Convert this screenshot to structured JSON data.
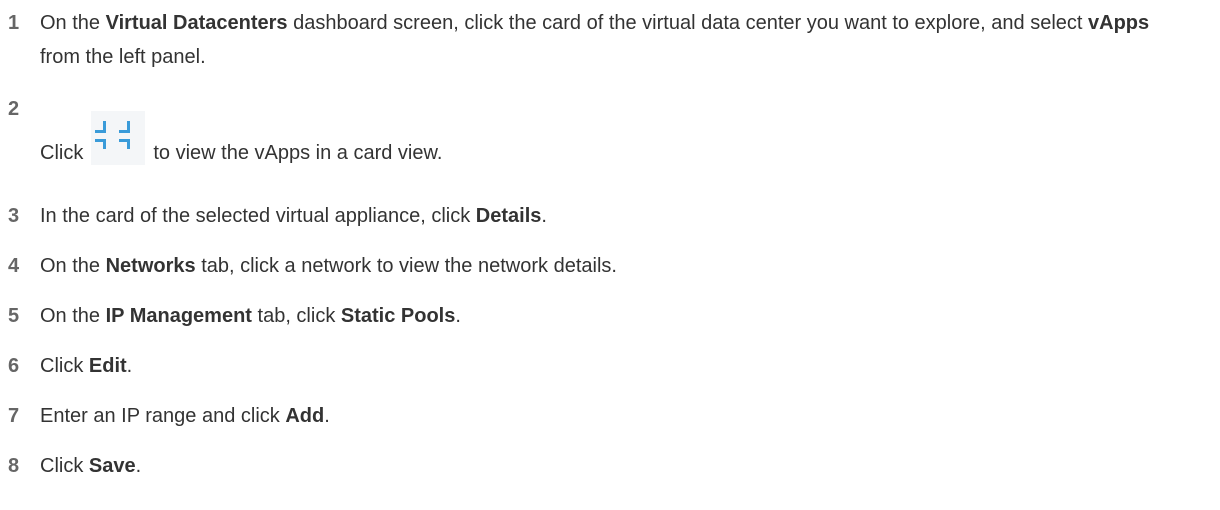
{
  "steps": [
    {
      "number": "1",
      "segments": [
        {
          "t": "On the "
        },
        {
          "t": "Virtual Datacenters",
          "b": true
        },
        {
          "t": " dashboard screen, click the card of the virtual data center you want to explore, and select "
        },
        {
          "t": "vApps",
          "b": true
        },
        {
          "t": " from the left panel."
        }
      ]
    },
    {
      "number": "2",
      "before_icon": "Click",
      "icon": "card-view-icon",
      "after_icon": "to view the vApps in a card view."
    },
    {
      "number": "3",
      "segments": [
        {
          "t": "In the card of the selected virtual appliance, click "
        },
        {
          "t": "Details",
          "b": true
        },
        {
          "t": "."
        }
      ]
    },
    {
      "number": "4",
      "segments": [
        {
          "t": "On the "
        },
        {
          "t": "Networks",
          "b": true
        },
        {
          "t": " tab, click a network to view the network details."
        }
      ]
    },
    {
      "number": "5",
      "segments": [
        {
          "t": "On the "
        },
        {
          "t": "IP Management",
          "b": true
        },
        {
          "t": " tab, click "
        },
        {
          "t": "Static Pools",
          "b": true
        },
        {
          "t": "."
        }
      ]
    },
    {
      "number": "6",
      "segments": [
        {
          "t": "Click "
        },
        {
          "t": "Edit",
          "b": true
        },
        {
          "t": "."
        }
      ]
    },
    {
      "number": "7",
      "segments": [
        {
          "t": "Enter an IP range and click "
        },
        {
          "t": "Add",
          "b": true
        },
        {
          "t": "."
        }
      ]
    },
    {
      "number": "8",
      "segments": [
        {
          "t": "Click "
        },
        {
          "t": "Save",
          "b": true
        },
        {
          "t": "."
        }
      ]
    }
  ],
  "colors": {
    "text": "#333333",
    "number": "#666666",
    "icon_accent": "#3a9bd9"
  }
}
